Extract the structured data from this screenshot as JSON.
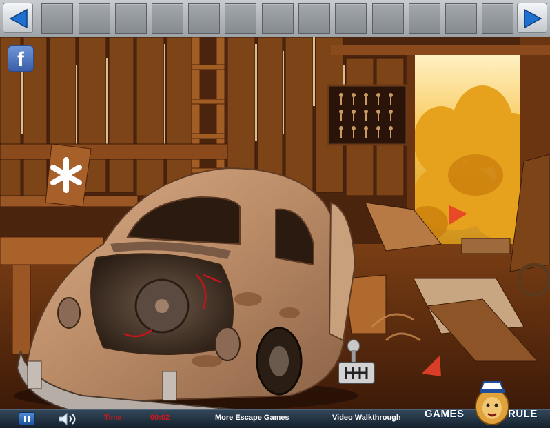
{
  "inventory": {
    "prev_label": "previous-inventory",
    "next_label": "next-inventory",
    "slot_count": 13
  },
  "hud": {
    "time_label": "Time",
    "time_value": "00:02",
    "more_games": "More Escape Games",
    "walkthrough": "Video Walkthrough",
    "brand_left": "GAMES",
    "brand_right": "RULE"
  },
  "buttons": {
    "facebook": "f"
  },
  "icons": {
    "prev": "arrow-left-icon",
    "next": "arrow-right-icon",
    "pause": "pause-icon",
    "sound": "speaker-icon",
    "hint": "asterisk-icon",
    "gear": "gear-shift-icon",
    "nav_right": "nav-arrow-right-icon",
    "nav_down": "nav-arrow-down-icon"
  },
  "colors": {
    "time": "#d3141b",
    "accent_blue": "#1f6fd0",
    "bar_top": "#c9ccd0"
  }
}
